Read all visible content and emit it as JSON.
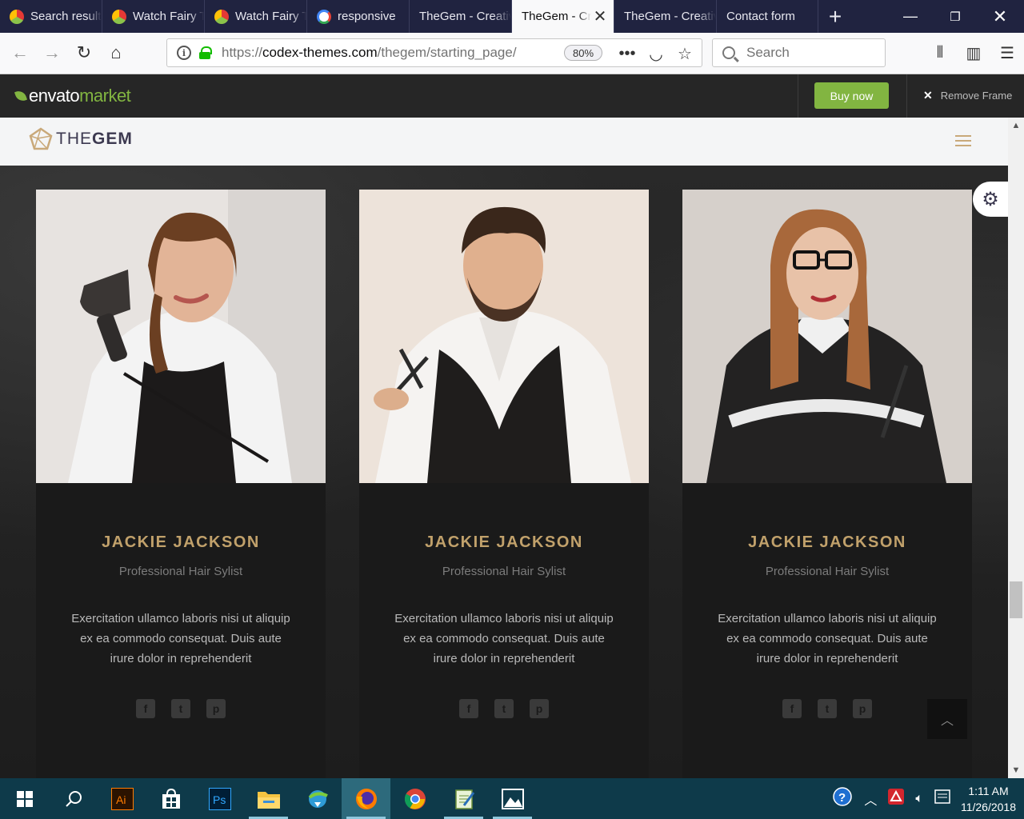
{
  "browser": {
    "tabs": [
      {
        "title": "Search results",
        "icon": "fairy-icon",
        "active": false
      },
      {
        "title": "Watch Fairy Tail",
        "icon": "fairy-icon",
        "active": false
      },
      {
        "title": "Watch Fairy Tail",
        "icon": "fairy-icon",
        "active": false
      },
      {
        "title": "responsive",
        "icon": "google-icon",
        "active": false
      },
      {
        "title": "TheGem - Creative",
        "icon": "",
        "active": false
      },
      {
        "title": "TheGem - Creative",
        "icon": "",
        "active": true
      },
      {
        "title": "TheGem - Creative",
        "icon": "",
        "active": false
      },
      {
        "title": "Contact form",
        "icon": "",
        "active": false
      }
    ],
    "url_scheme": "https://",
    "url_host": "codex-themes.com",
    "url_path": "/thegem/starting_page/",
    "zoom": "80%",
    "search_placeholder": "Search"
  },
  "envato": {
    "logo_a": "envato",
    "logo_b": "market",
    "buy_label": "Buy now",
    "remove_label": "Remove Frame",
    "accent": "#82b541"
  },
  "site": {
    "logo_light": "THE",
    "logo_bold": "GEM",
    "accent": "#c1a16b",
    "team": [
      {
        "name": "JACKIE JACKSON",
        "role": "Professional Hair Sylist",
        "bio": "Exercitation ullamco laboris nisi ut aliquip ex ea commodo consequat. Duis aute irure dolor in reprehenderit"
      },
      {
        "name": "JACKIE JACKSON",
        "role": "Professional Hair Sylist",
        "bio": "Exercitation ullamco laboris nisi ut aliquip ex ea commodo consequat. Duis aute irure dolor in reprehenderit"
      },
      {
        "name": "JACKIE JACKSON",
        "role": "Professional Hair Sylist",
        "bio": "Exercitation ullamco laboris nisi ut aliquip ex ea commodo consequat. Duis aute irure dolor in reprehenderit"
      }
    ],
    "social_icons": [
      "facebook-icon",
      "twitter-icon",
      "pinterest-icon"
    ]
  },
  "taskbar": {
    "time": "1:11 AM",
    "date": "11/26/2018",
    "apps": [
      "illustrator-icon",
      "store-icon",
      "photoshop-icon",
      "file-explorer-icon",
      "downloader-icon",
      "firefox-icon",
      "chrome-icon",
      "notepad-icon",
      "photos-icon"
    ]
  }
}
